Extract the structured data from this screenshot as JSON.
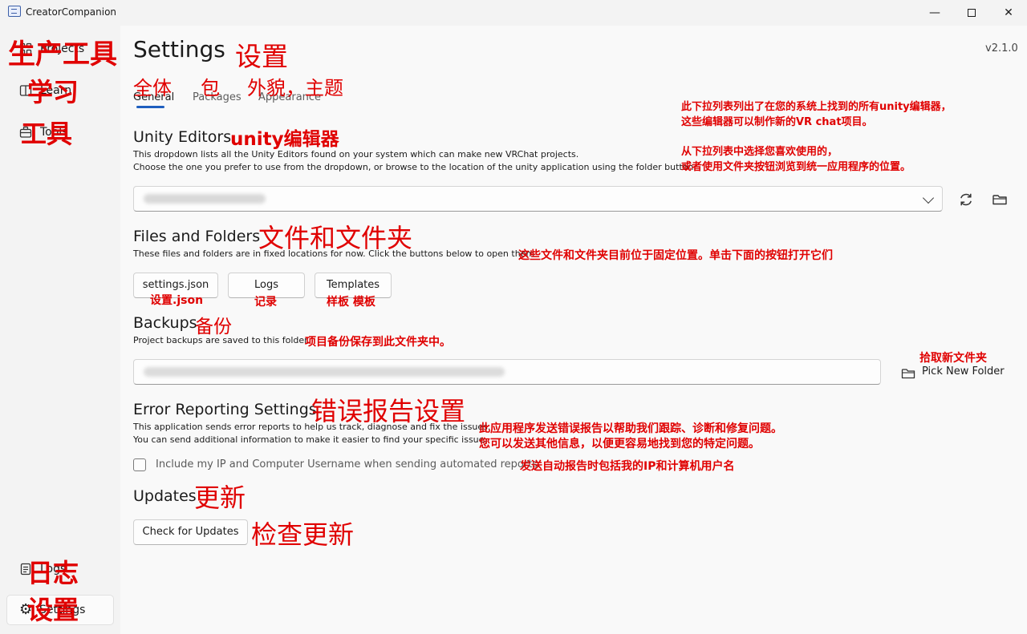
{
  "window": {
    "title": "CreatorCompanion",
    "minimize": "—",
    "maximize": "",
    "close": "✕"
  },
  "sidebar": {
    "items": [
      {
        "label": "Projects",
        "icon": "grid-icon",
        "annotation": "生产工具"
      },
      {
        "label": "Learn",
        "icon": "book-icon",
        "annotation": "学习"
      },
      {
        "label": "Tools",
        "icon": "toolbox-icon",
        "annotation": "工具"
      }
    ],
    "bottom_items": [
      {
        "label": "Logs",
        "icon": "document-icon",
        "annotation": "日志"
      },
      {
        "label": "Settings",
        "icon": "gear-icon",
        "annotation": "设置",
        "active": true
      }
    ]
  },
  "header": {
    "title": "Settings",
    "title_annotation": "设置",
    "version": "v2.1.0"
  },
  "tabs": [
    {
      "label": "General",
      "annotation": "全体",
      "active": true
    },
    {
      "label": "Packages",
      "annotation": "包"
    },
    {
      "label": "Appearance",
      "annotation": "外貌，主题"
    }
  ],
  "unity_editors": {
    "title": "Unity Editors",
    "title_annotation": "unity编辑器",
    "desc_line1": "This dropdown lists all the Unity Editors found on your system which can make new VRChat projects.",
    "desc_line2": "Choose the one you prefer to use from the dropdown, or browse to the location of the unity application using the folder button.",
    "annotation_line1": "此下拉列表列出了在您的系统上找到的所有unity编辑器，",
    "annotation_line2": "这些编辑器可以制作新的VR chat项目。",
    "annotation_line3": "从下拉列表中选择您喜欢使用的，",
    "annotation_line4": "或者使用文件夹按钮浏览到统一应用程序的位置。"
  },
  "files_folders": {
    "title": "Files and Folders",
    "title_annotation": "文件和文件夹",
    "desc": "These files and folders are in fixed locations for now. Click the buttons below to open them",
    "desc_annotation": "这些文件和文件夹目前位于固定位置。单击下面的按钮打开它们",
    "buttons": [
      {
        "label": "settings.json",
        "annotation": "设置.json"
      },
      {
        "label": "Logs",
        "annotation": "记录"
      },
      {
        "label": "Templates",
        "annotation": "样板  模板"
      }
    ]
  },
  "backups": {
    "title": "Backups",
    "title_annotation": "备份",
    "desc": "Project backups are saved to this folder.",
    "desc_annotation": "项目备份保存到此文件夹中。",
    "pick_label": "Pick New Folder",
    "pick_annotation": "拾取新文件夹"
  },
  "error_reporting": {
    "title": "Error Reporting Settings",
    "title_annotation": "错误报告设置",
    "desc_line1": "This application sends error reports to help us track, diagnose and fix the issues.",
    "desc_line2": "You can send additional information to make it easier to find your specific issue.",
    "annotation_line1": "此应用程序发送错误报告以帮助我们跟踪、诊断和修复问题。",
    "annotation_line2": "您可以发送其他信息，以便更容易地找到您的特定问题。",
    "checkbox_label": "Include my IP and Computer Username when sending automated reports",
    "checkbox_annotation": "发送自动报告时包括我的IP和计算机用户名",
    "checked": false
  },
  "updates": {
    "title": "Updates",
    "title_annotation": "更新",
    "button_label": "Check for Updates",
    "button_annotation": "检查更新"
  },
  "colors": {
    "annotation": "#e00000",
    "accent": "#1f5fbf"
  }
}
